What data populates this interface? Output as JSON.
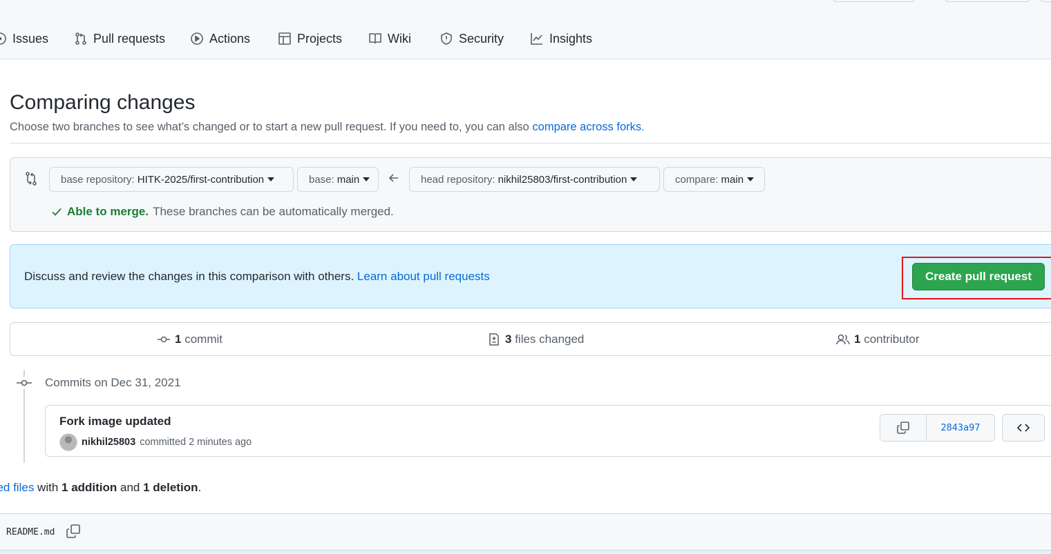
{
  "repo_nav": {
    "items": [
      {
        "label": "Issues",
        "icon": "issue-opened-icon"
      },
      {
        "label": "Pull requests",
        "icon": "git-pull-request-icon"
      },
      {
        "label": "Actions",
        "icon": "play-icon"
      },
      {
        "label": "Projects",
        "icon": "table-icon"
      },
      {
        "label": "Wiki",
        "icon": "book-icon"
      },
      {
        "label": "Security",
        "icon": "shield-icon"
      },
      {
        "label": "Insights",
        "icon": "graph-icon"
      }
    ]
  },
  "header": {
    "title": "Comparing changes",
    "subtitle": "Choose two branches to see what’s changed or to start a new pull request. If you need to, you can also ",
    "subtitle_link": "compare across forks",
    "subtitle_end": "."
  },
  "range": {
    "base_repo_label": "base repository:",
    "base_repo_value": "HITK-2025/first-contribution",
    "base_label": "base:",
    "base_value": "main",
    "head_repo_label": "head repository:",
    "head_repo_value": "nikhil25803/first-contribution",
    "compare_label": "compare:",
    "compare_value": "main",
    "merge_status": "Able to merge.",
    "merge_message": "These branches can be automatically merged."
  },
  "blankslate": {
    "text": "Discuss and review the changes in this comparison with others. ",
    "link": "Learn about pull requests",
    "button": "Create pull request"
  },
  "summary": {
    "commits_count": "1",
    "commits_label": "commit",
    "files_count": "3",
    "files_label": "files changed",
    "contributors_count": "1",
    "contributors_label": "contributor"
  },
  "commits": {
    "date_heading": "Commits on Dec 31, 2021",
    "items": [
      {
        "title": "Fork image updated",
        "author": "nikhil25803",
        "meta": "committed 2 minutes ago",
        "sha": "2843a97"
      }
    ]
  },
  "diff_stats": {
    "link": "ged files",
    "with": " with ",
    "additions": "1 addition",
    "and": " and ",
    "deletions": "1 deletion",
    "end": "."
  },
  "file": {
    "name": "README.md"
  },
  "colors": {
    "accent_link": "#0969da",
    "success": "#1a7f37",
    "primary_button": "#2da44e",
    "highlight_box": "#e5131e",
    "info_bg": "#ddf4ff"
  }
}
